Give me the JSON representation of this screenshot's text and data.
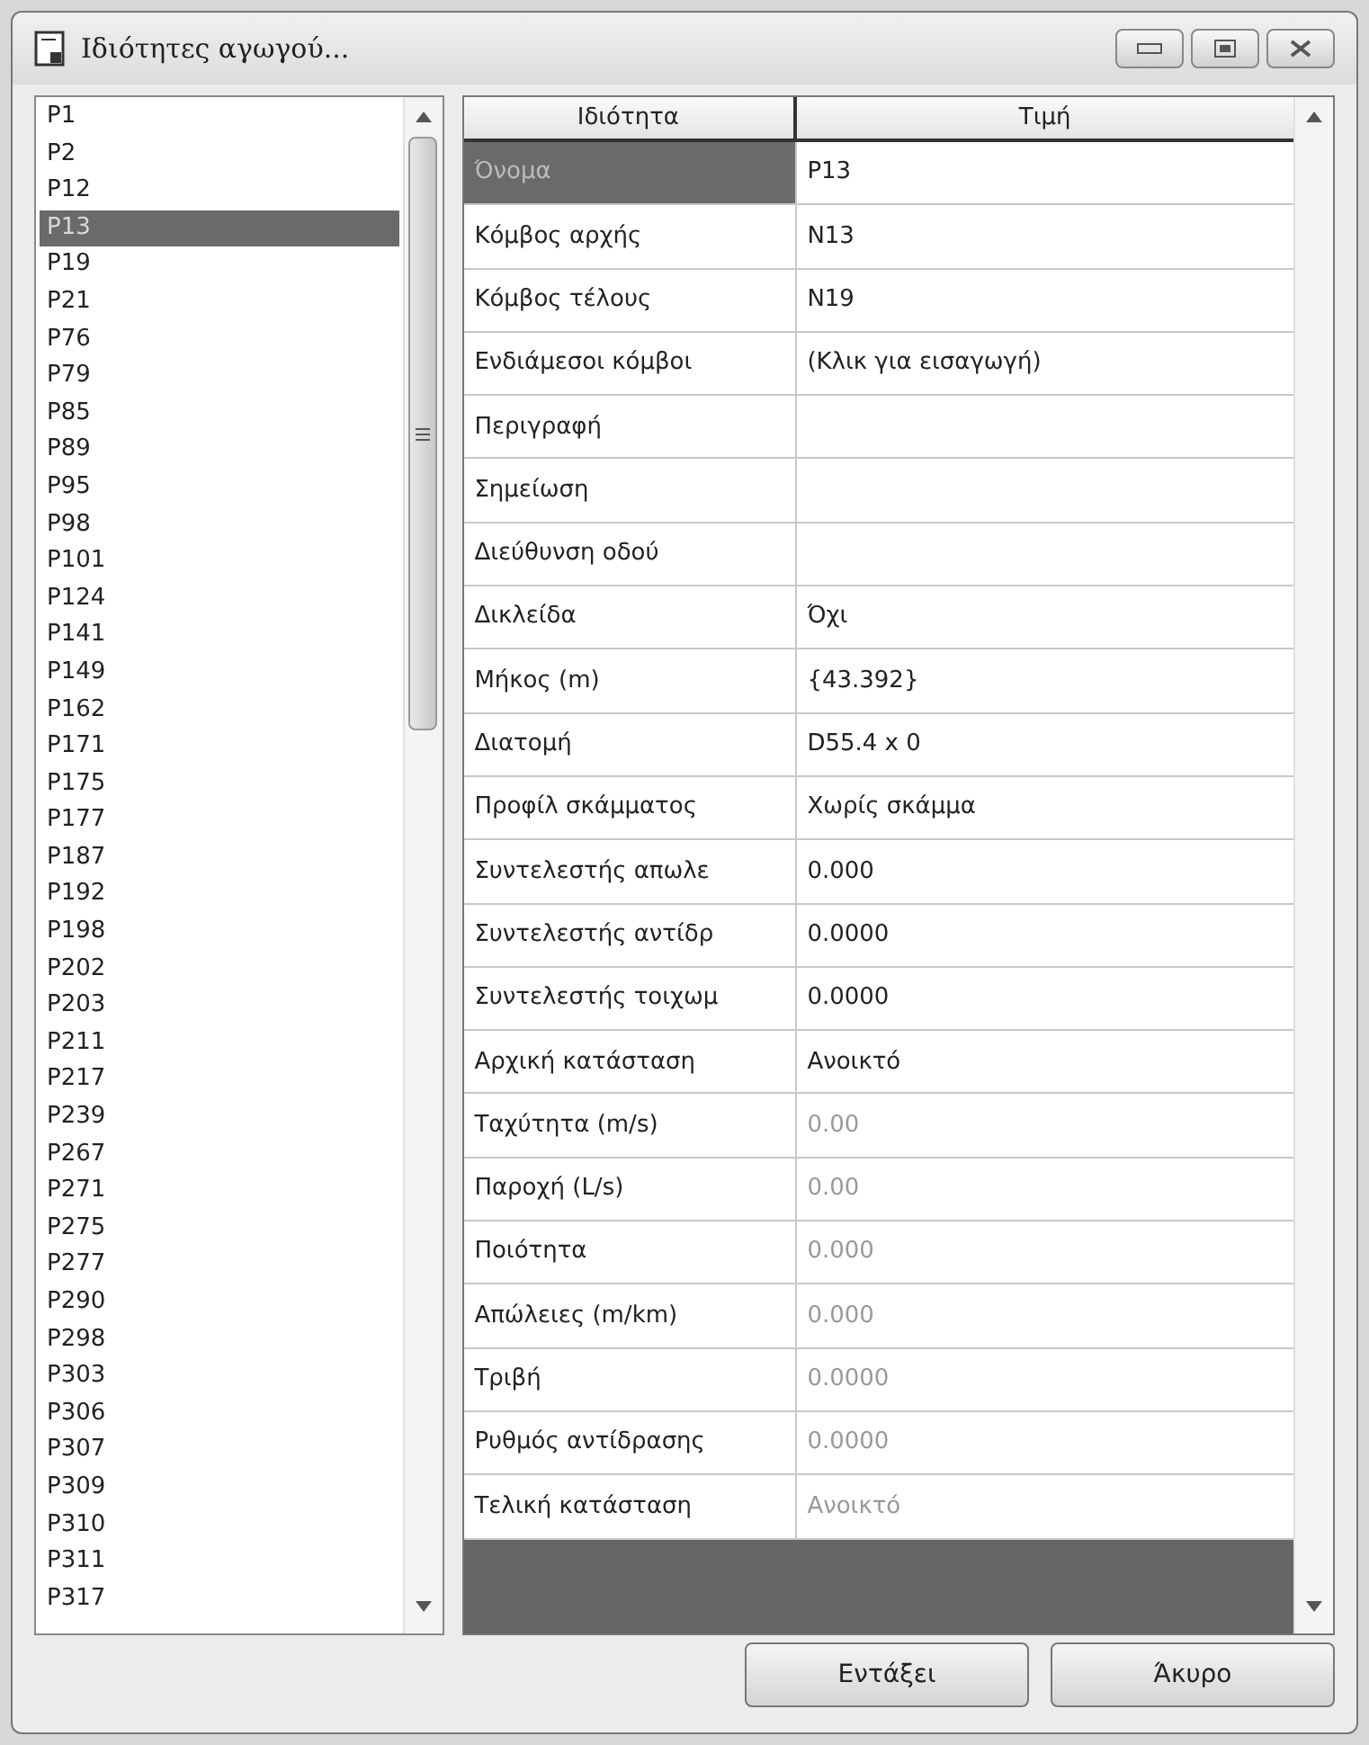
{
  "window": {
    "title": "Ιδιότητες αγωγού..."
  },
  "list": {
    "items": [
      {
        "label": "P1",
        "selected": false
      },
      {
        "label": "P2",
        "selected": false
      },
      {
        "label": "P12",
        "selected": false
      },
      {
        "label": "P13",
        "selected": true
      },
      {
        "label": "P19",
        "selected": false
      },
      {
        "label": "P21",
        "selected": false
      },
      {
        "label": "P76",
        "selected": false
      },
      {
        "label": "P79",
        "selected": false
      },
      {
        "label": "P85",
        "selected": false
      },
      {
        "label": "P89",
        "selected": false
      },
      {
        "label": "P95",
        "selected": false
      },
      {
        "label": "P98",
        "selected": false
      },
      {
        "label": "P101",
        "selected": false
      },
      {
        "label": "P124",
        "selected": false
      },
      {
        "label": "P141",
        "selected": false
      },
      {
        "label": "P149",
        "selected": false
      },
      {
        "label": "P162",
        "selected": false
      },
      {
        "label": "P171",
        "selected": false
      },
      {
        "label": "P175",
        "selected": false
      },
      {
        "label": "P177",
        "selected": false
      },
      {
        "label": "P187",
        "selected": false
      },
      {
        "label": "P192",
        "selected": false
      },
      {
        "label": "P198",
        "selected": false
      },
      {
        "label": "P202",
        "selected": false
      },
      {
        "label": "P203",
        "selected": false
      },
      {
        "label": "P211",
        "selected": false
      },
      {
        "label": "P217",
        "selected": false
      },
      {
        "label": "P239",
        "selected": false
      },
      {
        "label": "P267",
        "selected": false
      },
      {
        "label": "P271",
        "selected": false
      },
      {
        "label": "P275",
        "selected": false
      },
      {
        "label": "P277",
        "selected": false
      },
      {
        "label": "P290",
        "selected": false
      },
      {
        "label": "P298",
        "selected": false
      },
      {
        "label": "P303",
        "selected": false
      },
      {
        "label": "P306",
        "selected": false
      },
      {
        "label": "P307",
        "selected": false
      },
      {
        "label": "P309",
        "selected": false
      },
      {
        "label": "P310",
        "selected": false
      },
      {
        "label": "P311",
        "selected": false
      },
      {
        "label": "P317",
        "selected": false
      }
    ]
  },
  "table": {
    "columns": [
      "Ιδιότητα",
      "Τιμή"
    ],
    "rows": [
      {
        "property": "Όνομα",
        "value": "P13",
        "selected": true,
        "disabled": false
      },
      {
        "property": "Κόμβος αρχής",
        "value": "N13",
        "selected": false,
        "disabled": false
      },
      {
        "property": "Κόμβος τέλους",
        "value": "N19",
        "selected": false,
        "disabled": false
      },
      {
        "property": "Ενδιάμεσοι κόμβοι",
        "value": "(Κλικ για εισαγωγή)",
        "selected": false,
        "disabled": false
      },
      {
        "property": "Περιγραφή",
        "selected": false
      },
      {
        "property": "Σημείωση",
        "selected": false
      },
      {
        "property": "Διεύθυνση οδού",
        "selected": false
      },
      {
        "property": "Δικλείδα",
        "value": "Όχι",
        "selected": false,
        "disabled": false
      },
      {
        "property": "Μήκος (m)",
        "value": "{43.392}",
        "selected": false,
        "disabled": false
      },
      {
        "property": "Διατομή",
        "value": "D55.4 x 0",
        "selected": false,
        "disabled": false
      },
      {
        "property": "Προφίλ σκάμματος",
        "value": "Χωρίς σκάμμα",
        "selected": false,
        "disabled": false
      },
      {
        "property": "Συντελεστής απωλε",
        "value": "0.000",
        "selected": false,
        "disabled": false
      },
      {
        "property": "Συντελεστής αντίδρ",
        "value": "0.0000",
        "selected": false,
        "disabled": false
      },
      {
        "property": "Συντελεστής τοιχωμ",
        "value": "0.0000",
        "selected": false,
        "disabled": false
      },
      {
        "property": "Αρχική κατάσταση",
        "value": "Ανοικτό",
        "selected": false,
        "disabled": false
      },
      {
        "property": "Ταχύτητα (m/s)",
        "value": "0.00",
        "selected": false,
        "disabled": true
      },
      {
        "property": "Παροχή (L/s)",
        "value": "0.00",
        "selected": false,
        "disabled": true
      },
      {
        "property": "Ποιότητα",
        "value": "0.000",
        "selected": false,
        "disabled": true
      },
      {
        "property": "Απώλειες (m/km)",
        "value": "0.000",
        "selected": false,
        "disabled": true
      },
      {
        "property": "Τριβή",
        "value": "0.0000",
        "selected": false,
        "disabled": true
      },
      {
        "property": "Ρυθμός αντίδρασης",
        "value": "0.0000",
        "selected": false,
        "disabled": true
      },
      {
        "property": "Τελική κατάσταση",
        "value": "Ανοικτό",
        "selected": false,
        "disabled": true
      }
    ]
  },
  "buttons": [
    "Εντάξει",
    "Άκυρο"
  ]
}
